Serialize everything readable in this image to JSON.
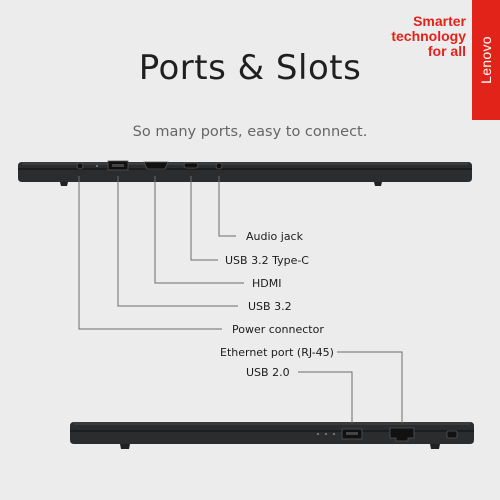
{
  "title": "Ports & Slots",
  "subtitle": "So many ports, easy to connect.",
  "brand": {
    "tagline": [
      "Smarter",
      "technology",
      "for all"
    ],
    "logo_text": "Lenovo",
    "color": "#e2231a"
  },
  "labels": {
    "audio_jack": "Audio jack",
    "usb_type_c": "USB 3.2 Type-C",
    "hdmi": "HDMI",
    "usb_32": "USB 3.2",
    "power_connector": "Power connector",
    "ethernet": "Ethernet port (RJ-45)",
    "usb_20": "USB 2.0"
  },
  "colors": {
    "laptop_body": "#2b2c2e",
    "laptop_edge": "#3a3b3d",
    "leader_lines": "#6b6b6b"
  }
}
